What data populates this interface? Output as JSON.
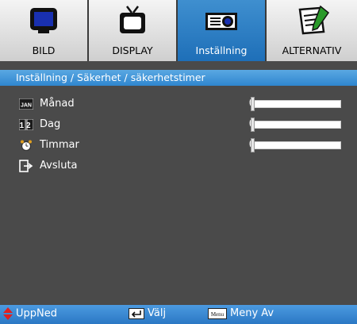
{
  "tabs": [
    {
      "label": "BILD",
      "icon": "monitor-icon",
      "active": false
    },
    {
      "label": "DISPLAY",
      "icon": "tv-icon",
      "active": false
    },
    {
      "label": "Inställning",
      "icon": "projector-icon",
      "active": true
    },
    {
      "label": "ALTERNATIV",
      "icon": "notepad-icon",
      "active": false
    }
  ],
  "breadcrumb": "Inställning / Säkerhet / säkerhetstimer",
  "items": [
    {
      "label": "Månad",
      "icon": "calendar-month-icon",
      "icon_text": "JAN",
      "value": "0",
      "level": 0
    },
    {
      "label": "Dag",
      "icon": "calendar-day-icon",
      "icon_text": "12",
      "value": "0",
      "level": 0
    },
    {
      "label": "Timmar",
      "icon": "alarm-clock-icon",
      "value": "0",
      "level": 0
    },
    {
      "label": "Avsluta",
      "icon": "exit-icon"
    }
  ],
  "footer": {
    "updown_label": "UppNed",
    "select_label": "Välj",
    "menu_key": "Menu",
    "menu_label": "Meny Av"
  },
  "colors": {
    "accent": "#2f86cf",
    "background": "#4a4a4a",
    "tab_inactive": "#e6e6e6"
  }
}
